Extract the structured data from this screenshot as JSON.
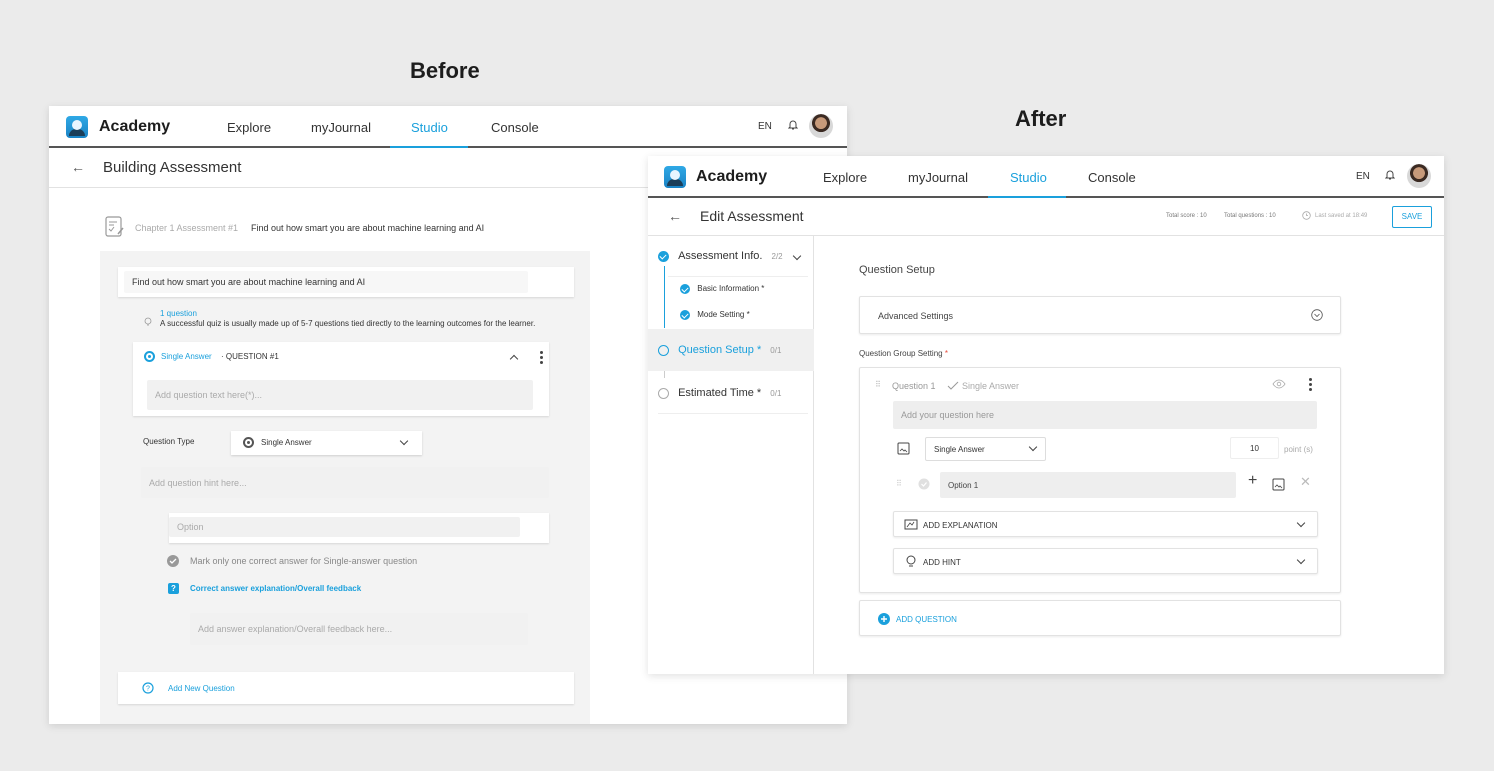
{
  "captions": {
    "before": "Before",
    "after": "After"
  },
  "nav": {
    "brand": "Academy",
    "links": [
      "Explore",
      "myJournal",
      "Studio",
      "Console"
    ],
    "active": "Studio",
    "lang": "EN"
  },
  "before": {
    "back": "←",
    "title": "Building Assessment",
    "breadcrumb_prefix": "Chapter 1 Assessment #1",
    "breadcrumb_title": "Find out how smart you are about machine learning and AI",
    "assessment_name": "Find out how smart you are about machine learning and AI",
    "tip_count": "1 question",
    "tip_text": "A successful quiz is usually made up of 5-7 questions tied directly to the learning outcomes for the learner.",
    "question_type_badge": "Single Answer",
    "question_number": "· QUESTION #1",
    "question_placeholder": "Add question text here(*)...",
    "question_type_label": "Question Type",
    "question_type_value": "Single Answer",
    "hint_placeholder": "Add question hint here...",
    "option_placeholder": "Option",
    "mark_correct_text": "Mark only one correct answer for Single-answer question",
    "explanation_link": "Correct answer explanation/Overall feedback",
    "explanation_placeholder": "Add answer explanation/Overall feedback here...",
    "add_question": "Add New Question"
  },
  "after": {
    "back": "←",
    "title": "Edit Assessment",
    "total_score": "Total score : 10",
    "total_questions": "Total questions : 10",
    "last_saved": "Last saved at 18:49",
    "save": "SAVE",
    "steps": {
      "info": {
        "label": "Assessment Info.",
        "frac": "2/2"
      },
      "basic": {
        "label": "Basic Information *"
      },
      "mode": {
        "label": "Mode Setting *"
      },
      "setup": {
        "label": "Question Setup *",
        "frac": "0/1"
      },
      "time": {
        "label": "Estimated Time *",
        "frac": "0/1"
      }
    },
    "section_title": "Question Setup",
    "advanced": "Advanced Settings",
    "group_label": "Question Group Setting",
    "required_mark": "*",
    "question_label": "Question 1",
    "question_type": "Single Answer",
    "question_placeholder": "Add your question here",
    "type_select": "Single Answer",
    "points_value": "10",
    "points_unit": "point (s)",
    "option_value": "Option 1",
    "add_explanation": "ADD EXPLANATION",
    "add_hint": "ADD HINT",
    "add_question": "ADD QUESTION"
  },
  "colors": {
    "accent": "#1aa0dc",
    "background": "#ebebeb"
  }
}
